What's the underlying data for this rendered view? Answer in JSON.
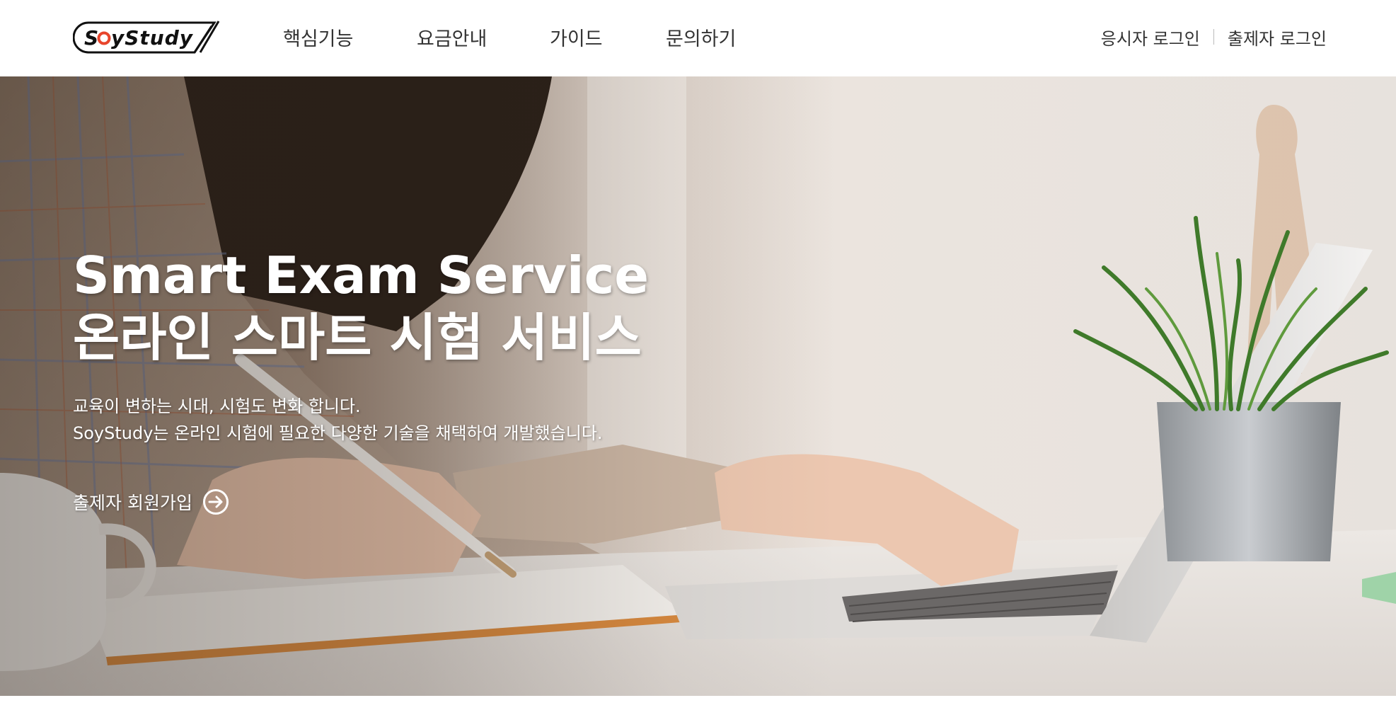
{
  "brand": {
    "logo_text": "SoyStudy"
  },
  "nav": {
    "items": [
      {
        "label": "핵심기능"
      },
      {
        "label": "요금안내"
      },
      {
        "label": "가이드"
      },
      {
        "label": "문의하기"
      }
    ]
  },
  "auth": {
    "examinee_login": "응시자 로그인",
    "examiner_login": "출제자 로그인"
  },
  "hero": {
    "title_en": "Smart Exam Service",
    "title_ko": "온라인 스마트 시험 서비스",
    "desc_line1": "교육이 변하는 시대, 시험도 변화 합니다.",
    "desc_line2": "SoyStudy는 온라인 시험에 필요한 다양한 기술을 채택하여 개발했습니다.",
    "cta_label": "출제자 회원가입",
    "cta_icon": "arrow-right-circle-icon"
  },
  "colors": {
    "text_dark": "#333333",
    "logo_accent": "#e8452c",
    "hero_text": "#ffffff"
  }
}
